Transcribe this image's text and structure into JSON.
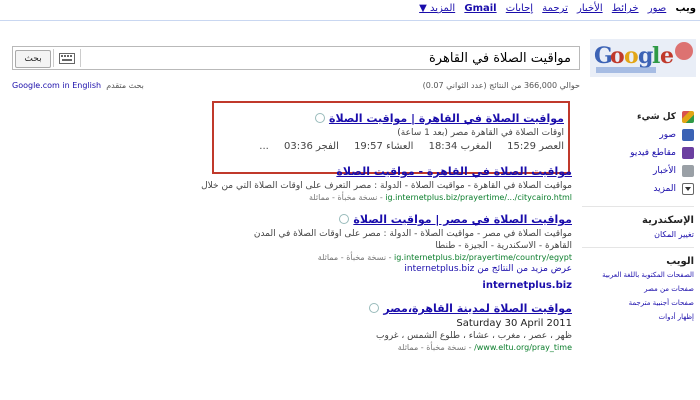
{
  "topbar": {
    "links": [
      "ويب",
      "صور",
      "خرائط",
      "الأخبار",
      "ترجمة",
      "إجابات",
      "Gmail",
      "المزيد ▼"
    ]
  },
  "search": {
    "query": "مواقيت الصلاة في القاهرة",
    "button_label": "بحث"
  },
  "stats": "حوالي 366,000 من النتائج (عدد الثواني 0.07)",
  "english_link": "Google.com in English",
  "english_prefix": "بحث متقدم",
  "sidebar": {
    "items": [
      {
        "label": "كل شيء",
        "icon": "all-icon",
        "bold": true
      },
      {
        "label": "صور",
        "icon": "images-icon",
        "bold": false
      },
      {
        "label": "مقاطع فيديو",
        "icon": "videos-icon",
        "bold": false
      },
      {
        "label": "الأخبار",
        "icon": "news-icon",
        "bold": false
      },
      {
        "label": "المزيد",
        "icon": "more-icon",
        "bold": false
      }
    ],
    "location_head": "الإسكندرية",
    "location_change": "تغيير المكان",
    "web_head": "الويب",
    "web_links": [
      "الصفحات المكتوبة باللغة العربية",
      "صفحات من مصر",
      "صفحات أجنبية مترجمة"
    ],
    "more_tools": "إظهار أدوات"
  },
  "results": [
    {
      "title": "مواقيت الصلاة في القاهرة | مواقيت الصلاة",
      "snippet": "أوقات الصلاة في القاهرة مصر (بعد 1 ساعة)",
      "times": [
        "العصر 15:29",
        "المغرب 18:34",
        "العشاء 19:57",
        "الفجر 03:36",
        "..."
      ]
    },
    {
      "title": "مواقيت الصلاة في القاهرة - مواقيت الصلاة",
      "snippet": "مواقيت الصلاة في القاهرة - مواقيت الصلاة - الدولة : مصر التعرف على أوقات الصلاة التي من خلال",
      "url": "ig.internetplus.biz/prayertime/.../citycairo.html",
      "cache": "- نسخة مخبأة - مماثلة"
    },
    {
      "title": "مواقيت الصلاة في مصر | مواقيت الصلاة",
      "snippet": "مواقيت الصلاة في مصر - مواقيت الصلاة - الدولة : مصر على أوقات الصلاة في المدن",
      "snippet2": "القاهرة - الاسكندرية - الجيزة - طنطا",
      "url": "ig.internetplus.biz/prayertime/country/egypt",
      "cache": "- نسخة مخبأة - مماثلة",
      "more_from": "عرض مزيد من النتائج من internetplus.biz"
    },
    {
      "title": "مواقيت الصلاة لمدينة القاهرة،مصر",
      "date": "Saturday 30 April 2011",
      "snippet": "ظهر ، عصر ، مغرب ، عشاء ، طلوع الشمس ، غروب",
      "url": "www.eltu.org/pray_time/",
      "cache": "- نسخة مخبأة - مماثلة"
    }
  ],
  "more_domain": "internetplus.biz",
  "colors": {
    "link": "#1a0dab",
    "url": "#0a7d2b",
    "highlight": "#c0392b"
  }
}
